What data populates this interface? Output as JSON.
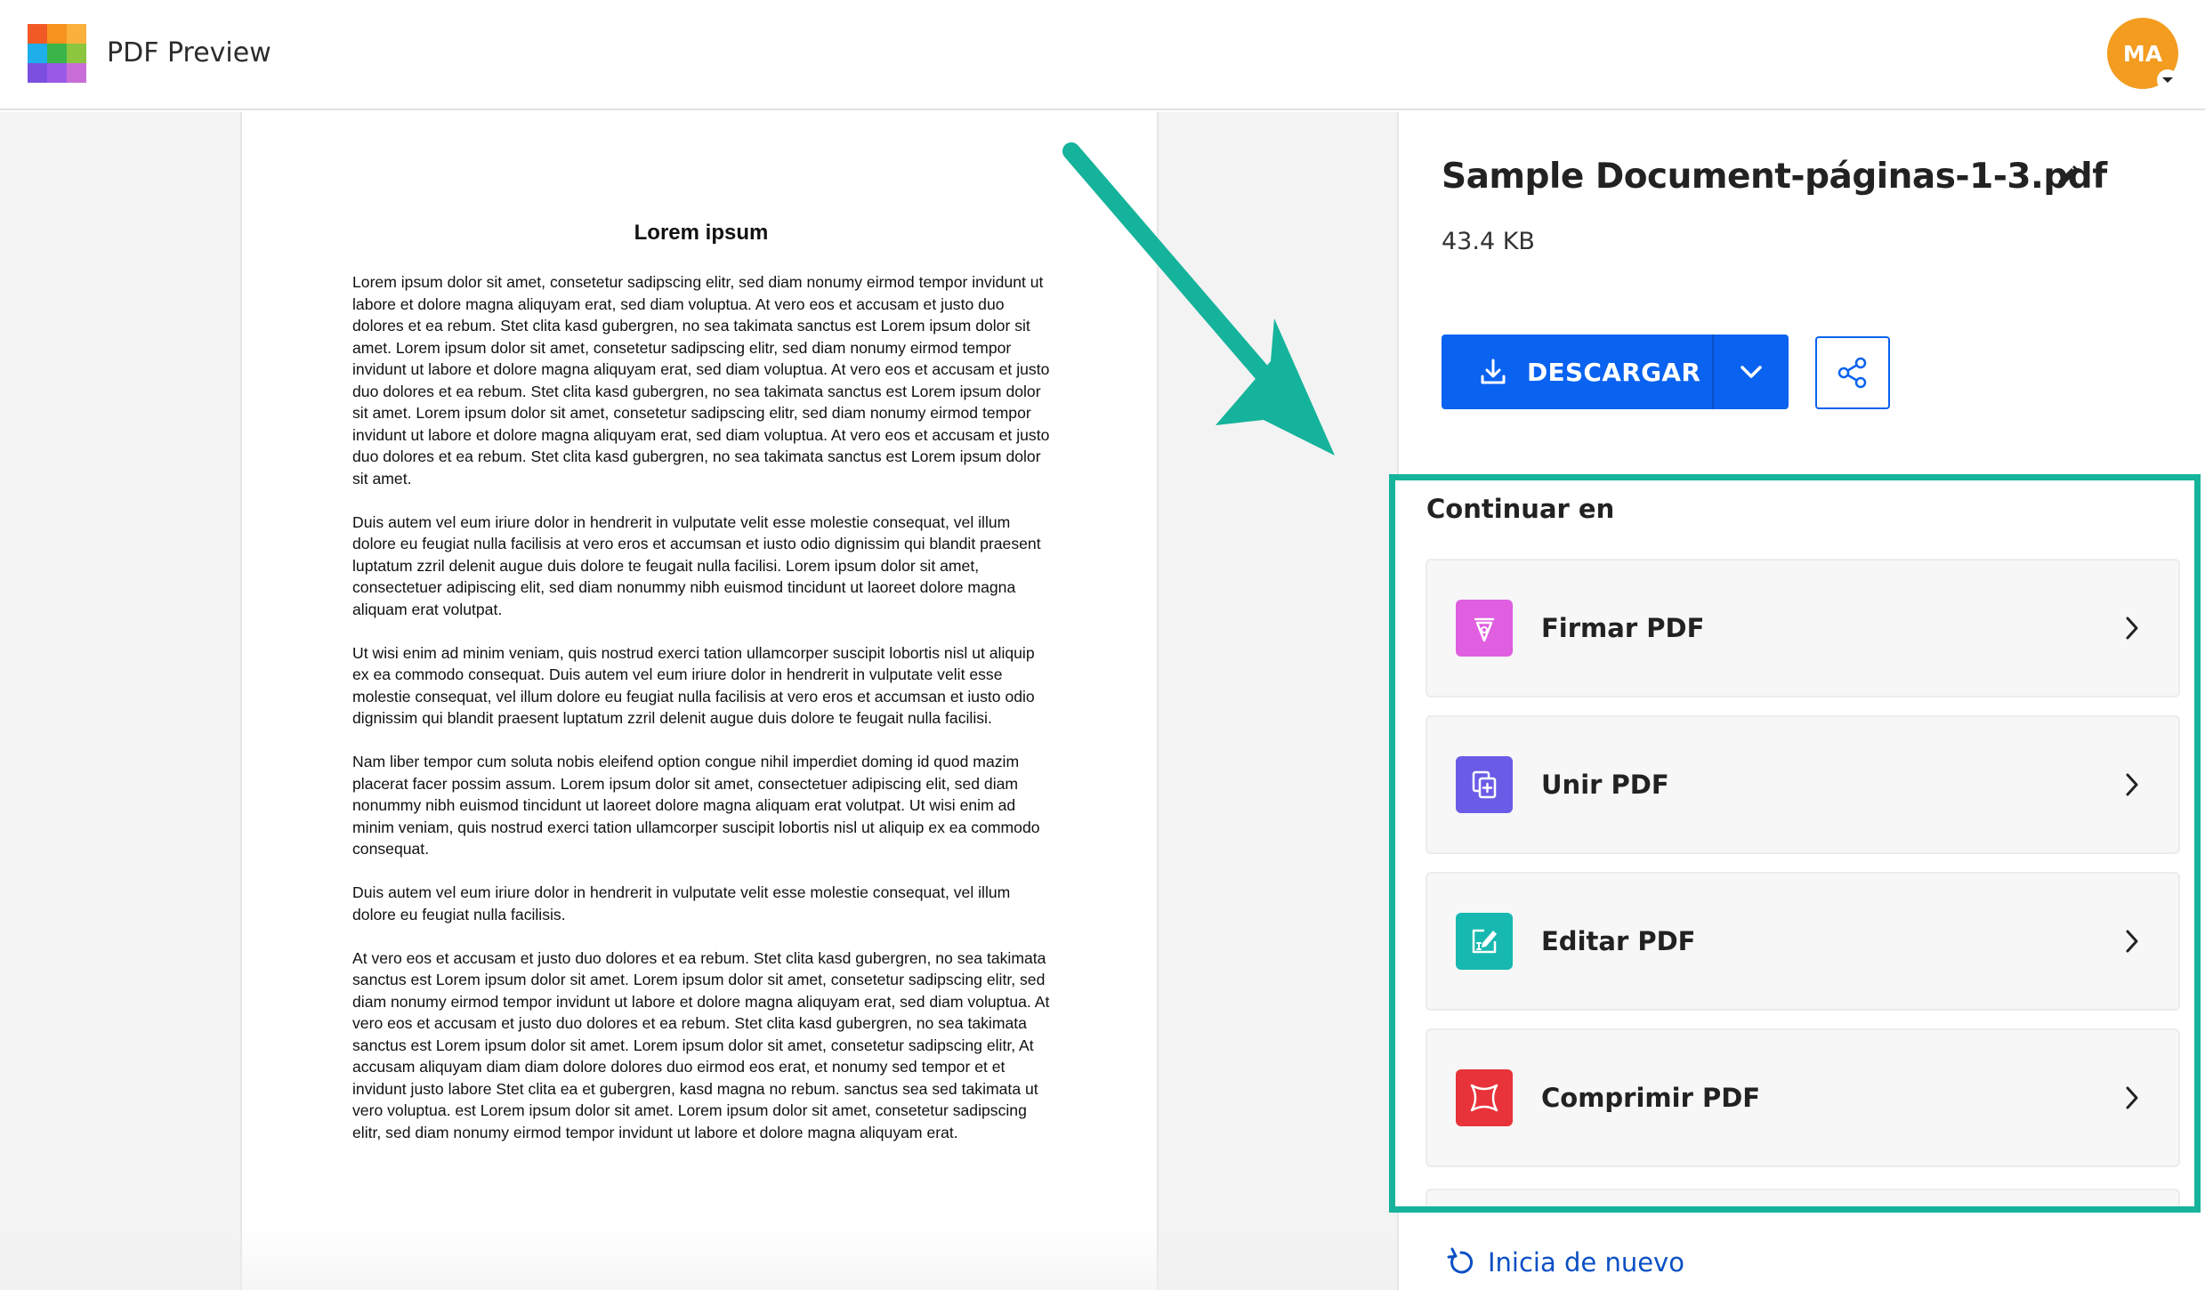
{
  "header": {
    "app_title": "PDF Preview",
    "avatar_initials": "MA",
    "logo_colors": [
      "#f15a24",
      "#f7931e",
      "#fbb03b",
      "#1eaeea",
      "#3bb54a",
      "#8cc63f",
      "#7b4fe0",
      "#9b59e8",
      "#c86dd7"
    ]
  },
  "document": {
    "title": "Lorem ipsum",
    "paragraphs": [
      "Lorem ipsum dolor sit amet, consetetur sadipscing elitr, sed diam nonumy eirmod tempor invidunt ut labore et dolore magna aliquyam erat, sed diam voluptua. At vero eos et accusam et justo duo dolores et ea rebum. Stet clita kasd gubergren, no sea takimata sanctus est Lorem ipsum dolor sit amet. Lorem ipsum dolor sit amet, consetetur sadipscing elitr, sed diam nonumy eirmod tempor invidunt ut labore et dolore magna aliquyam erat, sed diam voluptua. At vero eos et accusam et justo duo dolores et ea rebum. Stet clita kasd gubergren, no sea takimata sanctus est Lorem ipsum dolor sit amet. Lorem ipsum dolor sit amet, consetetur sadipscing elitr, sed diam nonumy eirmod tempor invidunt ut labore et dolore magna aliquyam erat, sed diam voluptua. At vero eos et accusam et justo duo dolores et ea rebum. Stet clita kasd gubergren, no sea takimata sanctus est Lorem ipsum dolor sit amet.",
      "Duis autem vel eum iriure dolor in hendrerit in vulputate velit esse molestie consequat, vel illum dolore eu feugiat nulla facilisis at vero eros et accumsan et iusto odio dignissim qui blandit praesent luptatum zzril delenit augue duis dolore te feugait nulla facilisi. Lorem ipsum dolor sit amet, consectetuer adipiscing elit, sed diam nonummy nibh euismod tincidunt ut laoreet dolore magna aliquam erat volutpat.",
      "Ut wisi enim ad minim veniam, quis nostrud exerci tation ullamcorper suscipit lobortis nisl ut aliquip ex ea commodo consequat. Duis autem vel eum iriure dolor in hendrerit in vulputate velit esse molestie consequat, vel illum dolore eu feugiat nulla facilisis at vero eros et accumsan et iusto odio dignissim qui blandit praesent luptatum zzril delenit augue duis dolore te feugait nulla facilisi.",
      "Nam liber tempor cum soluta nobis eleifend option congue nihil imperdiet doming id quod mazim placerat facer possim assum. Lorem ipsum dolor sit amet, consectetuer adipiscing elit, sed diam nonummy nibh euismod tincidunt ut laoreet dolore magna aliquam erat volutpat. Ut wisi enim ad minim veniam, quis nostrud exerci tation ullamcorper suscipit lobortis nisl ut aliquip ex ea commodo consequat.",
      "Duis autem vel eum iriure dolor in hendrerit in vulputate velit esse molestie consequat, vel illum dolore eu feugiat nulla facilisis.",
      "At vero eos et accusam et justo duo dolores et ea rebum. Stet clita kasd gubergren, no sea takimata sanctus est Lorem ipsum dolor sit amet. Lorem ipsum dolor sit amet, consetetur sadipscing elitr, sed diam nonumy eirmod tempor invidunt ut labore et dolore magna aliquyam erat, sed diam voluptua. At vero eos et accusam et justo duo dolores et ea rebum. Stet clita kasd gubergren, no sea takimata sanctus est Lorem ipsum dolor sit amet. Lorem ipsum dolor sit amet, consetetur sadipscing elitr, At accusam aliquyam diam diam dolore dolores duo eirmod eos erat, et nonumy sed tempor et et invidunt justo labore Stet clita ea et gubergren, kasd magna no rebum. sanctus sea sed takimata ut vero voluptua. est Lorem ipsum dolor sit amet. Lorem ipsum dolor sit amet, consetetur sadipscing elitr, sed diam nonumy eirmod tempor invidunt ut labore et dolore magna aliquyam erat."
    ]
  },
  "panel": {
    "file_name": "Sample Document-páginas-1-3.pdf",
    "file_size": "43.4 KB",
    "download_label": "DESCARGAR",
    "continue_title": "Continuar en",
    "tools": [
      {
        "label": "Firmar PDF",
        "icon": "sign-pen-icon",
        "color": "#e05ee0"
      },
      {
        "label": "Unir PDF",
        "icon": "merge-icon",
        "color": "#6b5ce7"
      },
      {
        "label": "Editar PDF",
        "icon": "edit-text-icon",
        "color": "#17b8b0"
      },
      {
        "label": "Comprimir PDF",
        "icon": "compress-icon",
        "color": "#e8333a"
      }
    ],
    "restart_label": "Inicia de nuevo"
  },
  "colors": {
    "primary": "#0a62f0",
    "highlight": "#15b39b",
    "avatar": "#f39c1f"
  }
}
